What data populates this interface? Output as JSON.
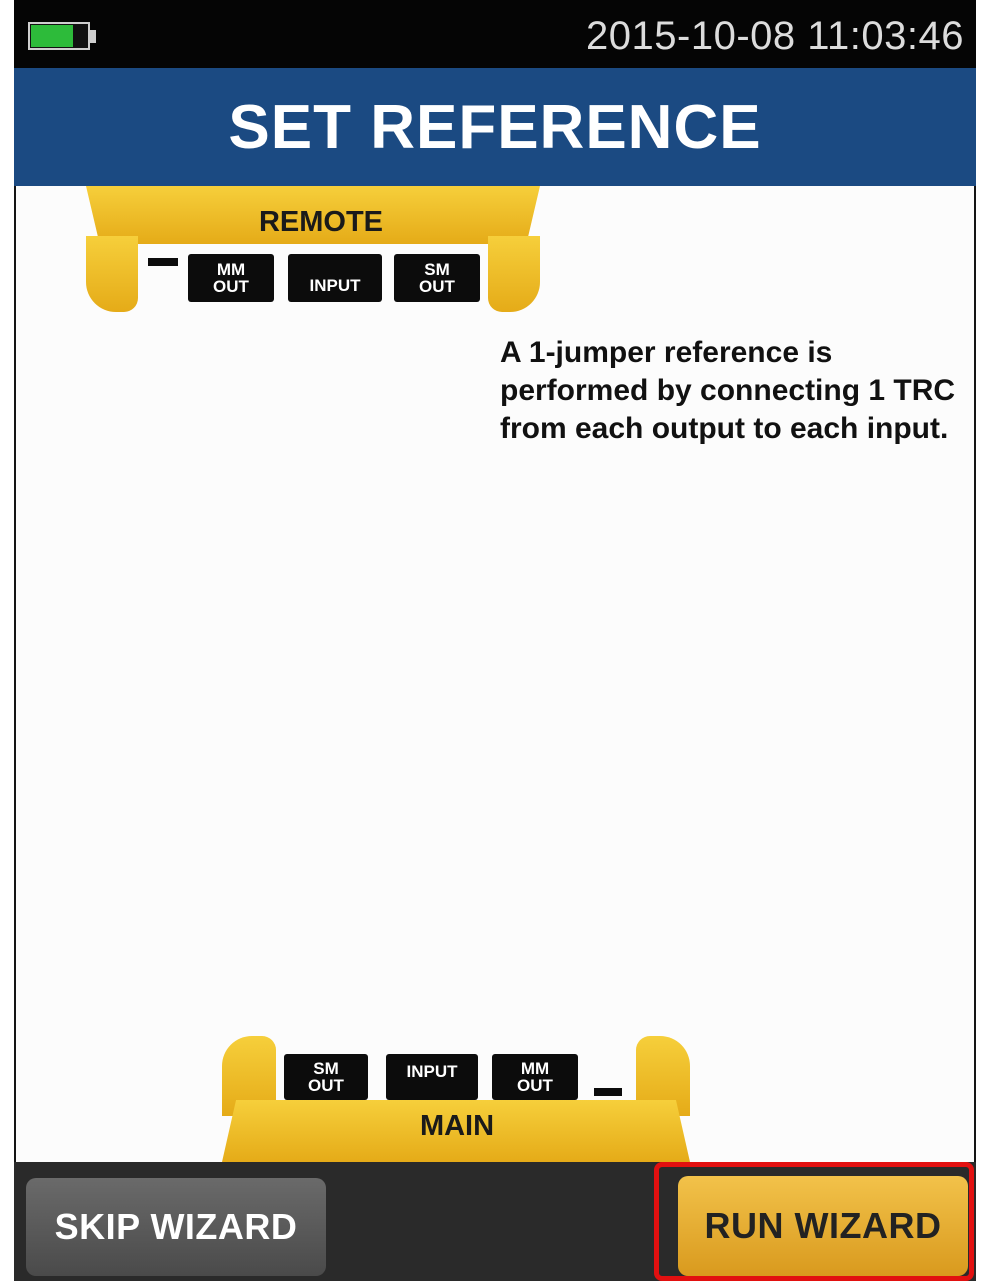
{
  "status_bar": {
    "battery": "battery-icon",
    "datetime": "2015-10-08 11:03:46"
  },
  "header": {
    "title": "SET REFERENCE"
  },
  "remote_unit": {
    "label": "REMOTE",
    "ports": [
      {
        "line1": "MM",
        "line2": "OUT"
      },
      {
        "line1": "INPUT",
        "line2": ""
      },
      {
        "line1": "SM",
        "line2": "OUT"
      }
    ]
  },
  "main_unit": {
    "label": "MAIN",
    "ports": [
      {
        "line1": "SM",
        "line2": "OUT"
      },
      {
        "line1": "INPUT",
        "line2": ""
      },
      {
        "line1": "MM",
        "line2": "OUT"
      }
    ]
  },
  "instruction": "A 1-jumper reference is performed by connecting 1 TRC from each output to each input.",
  "buttons": {
    "skip": "SKIP WIZARD",
    "run": "RUN WIZARD"
  },
  "colors": {
    "header_bg": "#1b4a82",
    "unit_yellow": "#f0c232",
    "highlight_border": "#e21010",
    "battery_fill": "#2dbb3a"
  }
}
